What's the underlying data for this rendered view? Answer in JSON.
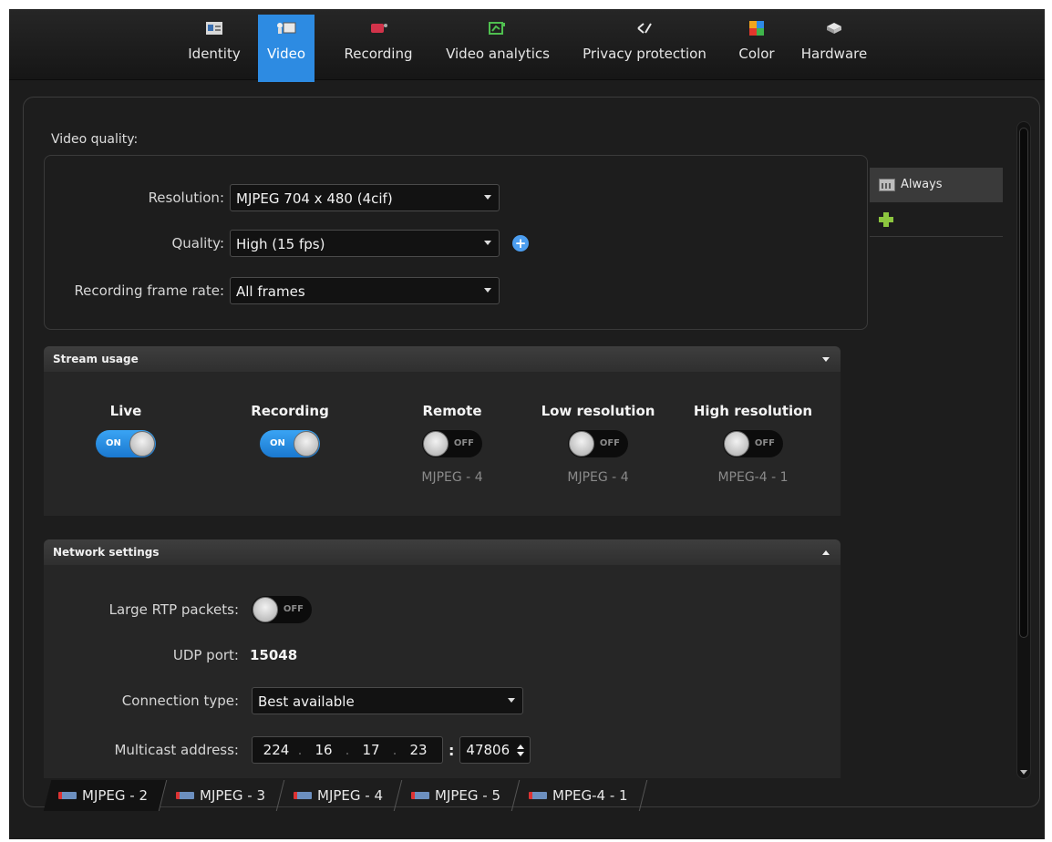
{
  "toolbar": {
    "tabs": [
      {
        "label": "Identity",
        "icon": "identity-card-icon"
      },
      {
        "label": "Video",
        "icon": "video-camera-icon",
        "active": true
      },
      {
        "label": "Recording",
        "icon": "recording-icon"
      },
      {
        "label": "Video analytics",
        "icon": "video-analytics-icon"
      },
      {
        "label": "Privacy protection",
        "icon": "privacy-protection-icon"
      },
      {
        "label": "Color",
        "icon": "color-icon"
      },
      {
        "label": "Hardware",
        "icon": "hardware-icon"
      }
    ]
  },
  "video_quality": {
    "title": "Video quality:",
    "resolution_label": "Resolution:",
    "resolution_value": "MJPEG 704 x 480 (4cif)",
    "quality_label": "Quality:",
    "quality_value": "High (15 fps)",
    "frame_rate_label": "Recording frame rate:",
    "frame_rate_value": "All frames"
  },
  "schedule": {
    "items": [
      {
        "label": "Always",
        "icon": "calendar-icon"
      }
    ],
    "add_icon": "add-plus-icon"
  },
  "stream_usage": {
    "title": "Stream usage",
    "columns": [
      {
        "label": "Live",
        "state": "ON",
        "format": ""
      },
      {
        "label": "Recording",
        "state": "ON",
        "format": ""
      },
      {
        "label": "Remote",
        "state": "OFF",
        "format": "MJPEG - 4"
      },
      {
        "label": "Low resolution",
        "state": "OFF",
        "format": "MJPEG - 4"
      },
      {
        "label": "High resolution",
        "state": "OFF",
        "format": "MPEG-4 - 1"
      }
    ]
  },
  "network_settings": {
    "title": "Network settings",
    "large_rtp_label": "Large RTP packets:",
    "large_rtp_state": "OFF",
    "udp_port_label": "UDP port:",
    "udp_port_value": "15048",
    "connection_type_label": "Connection type:",
    "connection_type_value": "Best available",
    "multicast_label": "Multicast address:",
    "multicast_octets": [
      "224",
      "16",
      "17",
      "23"
    ],
    "multicast_port": "47806"
  },
  "stream_tabs": [
    {
      "label": "MJPEG - 2",
      "active": true
    },
    {
      "label": "MJPEG - 3"
    },
    {
      "label": "MJPEG - 4"
    },
    {
      "label": "MJPEG - 5"
    },
    {
      "label": "MPEG-4 - 1"
    }
  ],
  "colors": {
    "accent": "#2d8be2",
    "background": "#1c1c1c",
    "toggle_on": "#1a78cf"
  }
}
